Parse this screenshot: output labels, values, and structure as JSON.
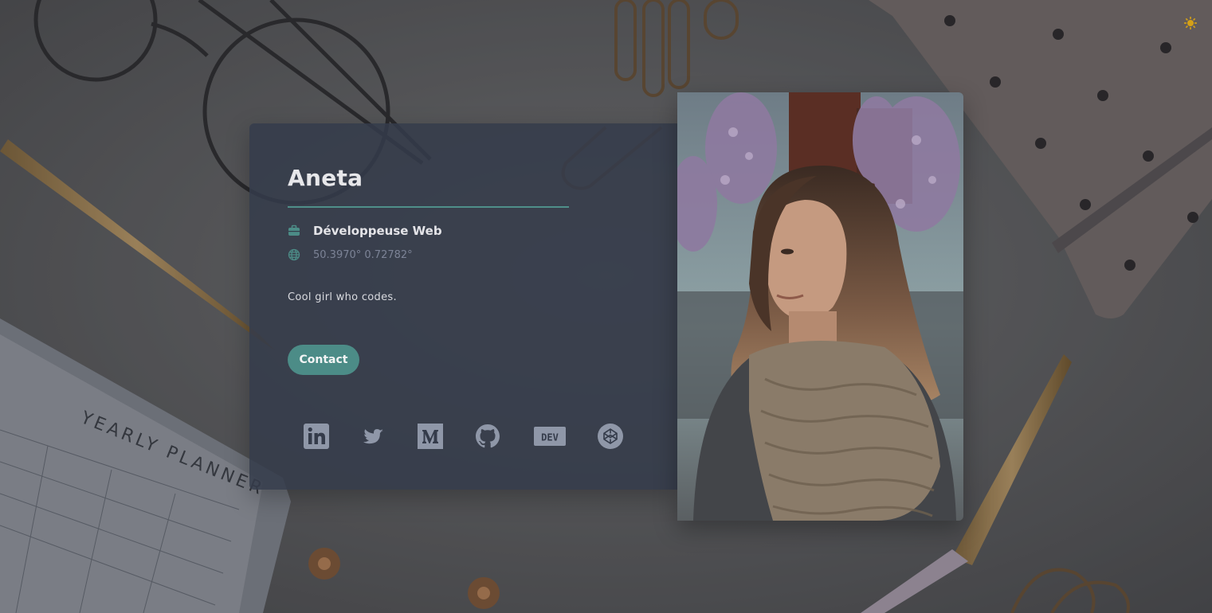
{
  "profile": {
    "name": "Aneta",
    "job_title": "Développeuse Web",
    "coordinates": "50.3970° 0.72782°",
    "bio": "Cool girl who codes.",
    "contact_label": "Contact",
    "photo_icon": "profile-photo"
  },
  "icons": {
    "job": "briefcase-icon",
    "location": "globe-icon",
    "theme_toggle": "sun-icon"
  },
  "socials": [
    {
      "name": "LinkedIn",
      "icon": "linkedin-icon"
    },
    {
      "name": "Twitter",
      "icon": "twitter-icon"
    },
    {
      "name": "Medium",
      "icon": "medium-icon"
    },
    {
      "name": "GitHub",
      "icon": "github-icon"
    },
    {
      "name": "DEV",
      "icon": "dev-icon",
      "label": "DEV"
    },
    {
      "name": "CodePen",
      "icon": "codepen-icon"
    }
  ],
  "colors": {
    "accent": "#4c8c87",
    "card_bg": "#343b4a",
    "social_icon": "#8f97a8",
    "sun": "#d4a017"
  }
}
